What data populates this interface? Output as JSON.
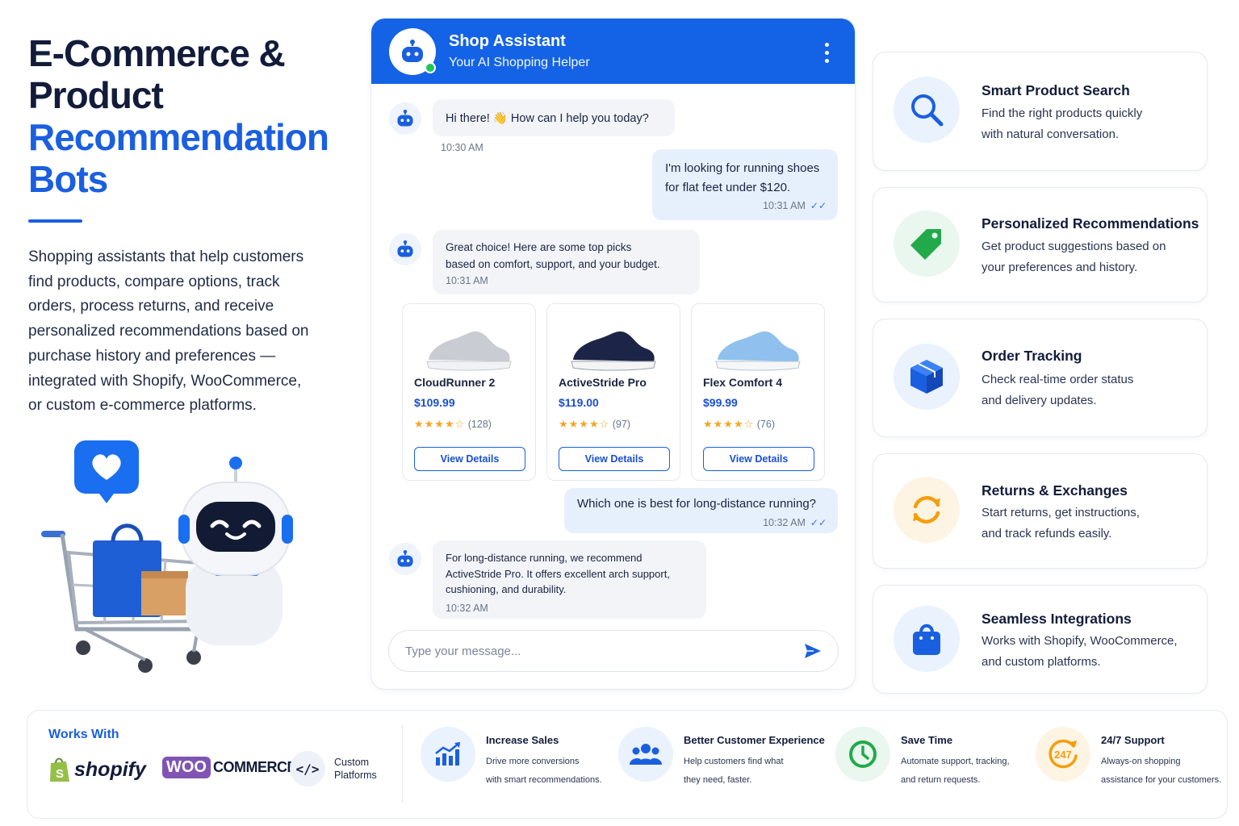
{
  "hero": {
    "title_line1": "E-Commerce &",
    "title_line2": "Product",
    "title_line3": "Recommendation",
    "title_line4": "Bots",
    "description": "Shopping assistants that help customers find products, compare options, track orders, process returns, and receive personalized recommendations based on purchase history and preferences — integrated with Shopify, WooCommerce, or custom e-commerce platforms."
  },
  "chat": {
    "title": "Shop Assistant",
    "subtitle": "Your AI Shopping Helper",
    "messages": [
      {
        "from": "bot",
        "text": "Hi there! 👋 How can I help you today?",
        "time": "10:30 AM"
      },
      {
        "from": "user",
        "line1": "I'm looking for running shoes",
        "line2": "for flat feet under $120.",
        "time": "10:31 AM"
      },
      {
        "from": "bot",
        "line1": "Great choice! Here are some top picks",
        "line2": "based on comfort, support, and your budget.",
        "time": "10:31 AM"
      },
      {
        "from": "user",
        "text": "Which one is best for long-distance running?",
        "time": "10:32 AM"
      },
      {
        "from": "bot",
        "line1": "For long-distance running, we recommend",
        "line2": "ActiveStride Pro. It offers excellent arch support,",
        "line3": "cushioning, and durability.",
        "time": "10:32 AM"
      }
    ],
    "products": [
      {
        "name": "CloudRunner 2",
        "price": "$109.99",
        "stars": "★★★★☆",
        "reviews": "(128)",
        "button": "View Details",
        "color": "#c9ccd2"
      },
      {
        "name": "ActiveStride Pro",
        "price": "$119.00",
        "stars": "★★★★☆",
        "reviews": "(97)",
        "button": "View Details",
        "color": "#1c2547"
      },
      {
        "name": "Flex Comfort 4",
        "price": "$99.99",
        "stars": "★★★★☆",
        "reviews": "(76)",
        "button": "View Details",
        "color": "#8fc0ee"
      }
    ],
    "input_placeholder": "Type your message..."
  },
  "features": [
    {
      "title": "Smart Product Search",
      "line1": "Find the right products quickly",
      "line2": "with natural conversation.",
      "icon": "search-icon",
      "color": "#1a5fe0"
    },
    {
      "title": "Personalized Recommendations",
      "line1": "Get product suggestions based on",
      "line2": "your preferences and history.",
      "icon": "tag-icon",
      "color": "#22a94a"
    },
    {
      "title": "Order Tracking",
      "line1": "Check real-time order status",
      "line2": "and delivery updates.",
      "icon": "box-icon",
      "color": "#1a5fe0"
    },
    {
      "title": "Returns & Exchanges",
      "line1": "Start returns, get instructions,",
      "line2": "and track refunds easily.",
      "icon": "refresh-icon",
      "color": "#f59e0b"
    },
    {
      "title": "Seamless Integrations",
      "line1": "Works with Shopify, WooCommerce,",
      "line2": "and custom platforms.",
      "icon": "shopping-bag-icon",
      "color": "#1a5fe0"
    }
  ],
  "bottom": {
    "works_with": "Works With",
    "shopify": "shopify",
    "woo_logo": "WOO",
    "woo_commerce": "COMMERCE",
    "custom_line1": "Custom",
    "custom_line2": "Platforms",
    "benefits": [
      {
        "title": "Increase Sales",
        "line1": "Drive more conversions",
        "line2": "with smart recommendations.",
        "icon": "chart-icon"
      },
      {
        "title": "Better Customer Experience",
        "line1": "Help customers find what",
        "line2": "they need, faster.",
        "icon": "users-icon"
      },
      {
        "title": "Save Time",
        "line1": "Automate support, tracking,",
        "line2": "and return requests.",
        "icon": "clock-icon"
      },
      {
        "title": "24/7 Support",
        "line1": "Always-on shopping",
        "line2": "assistance for your customers.",
        "icon": "support-247-icon",
        "badge": "247"
      }
    ]
  }
}
